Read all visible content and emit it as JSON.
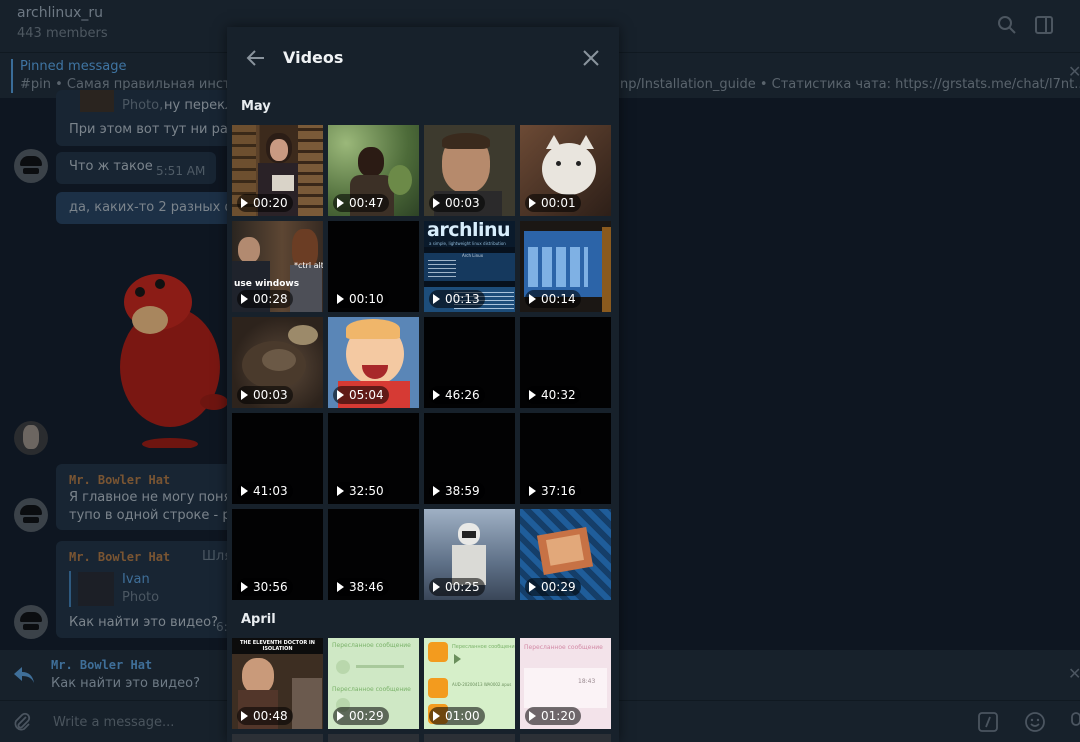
{
  "chat": {
    "title": "archlinux_ru",
    "members": "443 members",
    "pinned_label": "Pinned message",
    "pinned_text_left": "#pin • Самая правильная инстру",
    "pinned_text_right": "np/Installation_guide  • Статистика чата: https://grstats.me/chat/l7nt...",
    "messages": [
      {
        "quote_name": "Photo,",
        "text": "ну перекл"
      },
      {
        "text": "При этом вот тут ни разу"
      },
      {
        "text": "Что ж такое",
        "time": "5:51 AM"
      },
      {
        "text": "да, каких-то 2 разных фло"
      },
      {
        "sender": "Mr. Bowler Hat",
        "line1": "Я главное не могу поняты",
        "line2": "тупо в одной строке - par"
      },
      {
        "sender": "Mr. Bowler Hat",
        "extra": "Шля",
        "quote_name": "Ivan",
        "quote_type": "Photo",
        "text": "Как найти это видео?",
        "time": "6:"
      }
    ],
    "reply_sender": "Mr. Bowler Hat",
    "reply_text": "Как найти это видео?",
    "compose_placeholder": "Write a message..."
  },
  "panel": {
    "title": "Videos",
    "sections": [
      {
        "label": "May"
      },
      {
        "label": "April"
      }
    ]
  },
  "videos_may": [
    {
      "dur": "00:20",
      "scene": "woman-reading"
    },
    {
      "dur": "00:47",
      "scene": "man-jungle"
    },
    {
      "dur": "00:03",
      "scene": "man-face"
    },
    {
      "dur": "00:01",
      "scene": "cat"
    },
    {
      "dur": "00:28",
      "scene": "use-windows"
    },
    {
      "dur": "00:10",
      "scene": "black"
    },
    {
      "dur": "00:13",
      "scene": "arch-boot"
    },
    {
      "dur": "00:14",
      "scene": "monitor"
    },
    {
      "dur": "00:03",
      "scene": "food"
    },
    {
      "dur": "05:04",
      "scene": "cartoon"
    },
    {
      "dur": "46:26",
      "scene": "black"
    },
    {
      "dur": "40:32",
      "scene": "black"
    },
    {
      "dur": "41:03",
      "scene": "black"
    },
    {
      "dur": "32:50",
      "scene": "black"
    },
    {
      "dur": "38:59",
      "scene": "black"
    },
    {
      "dur": "37:16",
      "scene": "black"
    },
    {
      "dur": "30:56",
      "scene": "black"
    },
    {
      "dur": "38:46",
      "scene": "black"
    },
    {
      "dur": "00:25",
      "scene": "astronaut"
    },
    {
      "dur": "00:29",
      "scene": "circuit"
    }
  ],
  "videos_april": [
    {
      "dur": "00:48",
      "scene": "doctor",
      "caption": "THE ELEVENTH DOCTOR IN ISOLATION"
    },
    {
      "dur": "00:29",
      "scene": "green-chat"
    },
    {
      "dur": "01:00",
      "scene": "audio-chat"
    },
    {
      "dur": "01:20",
      "scene": "pink-chat"
    }
  ],
  "thumb_texts": {
    "use_windows": "use windows",
    "ctrl_alt": "*ctrl alt",
    "arch_logo": "archlinu",
    "arch_sub": "a simple, lightweight linux distribution",
    "arch_menu": "Arch Linux",
    "forwarded": "Пересланное сообщение",
    "audio_file": "AUD-20200413 WA0002.opus",
    "pink_time": "18:43"
  },
  "colors": {
    "panel_bg": "#17212b",
    "chat_bg": "#0e1621",
    "accent": "#3f75a3",
    "sender": "#7a5532"
  }
}
